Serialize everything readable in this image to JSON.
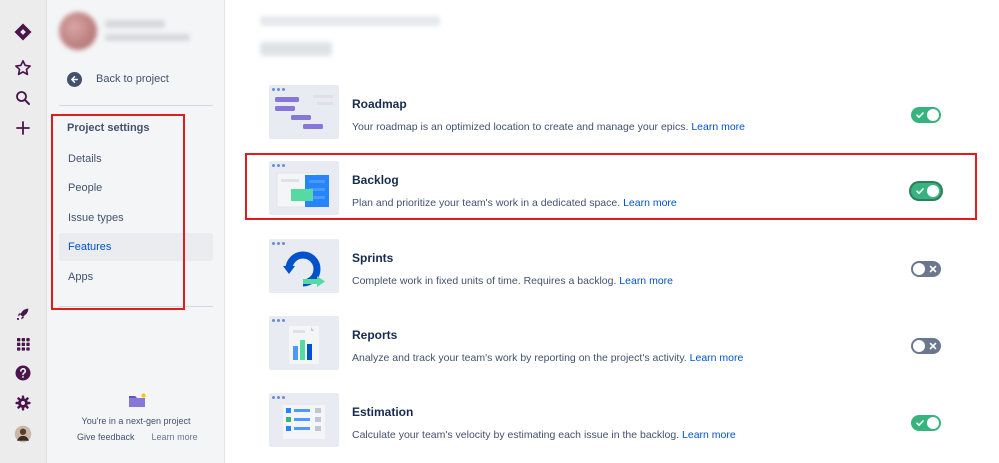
{
  "sidebar": {
    "back_label": "Back to project",
    "section_title": "Project settings",
    "items": [
      {
        "label": "Details",
        "active": false
      },
      {
        "label": "People",
        "active": false
      },
      {
        "label": "Issue types",
        "active": false
      },
      {
        "label": "Features",
        "active": true
      },
      {
        "label": "Apps",
        "active": false
      }
    ],
    "nextgen_text": "You're in a next-gen project",
    "feedback_label": "Give feedback",
    "learn_more_label": "Learn more"
  },
  "rail": {
    "icons": [
      "jira-logo-icon",
      "star-icon",
      "search-icon",
      "plus-icon",
      "rocket-icon",
      "apps-grid-icon",
      "help-icon",
      "settings-gear-icon",
      "user-avatar-icon"
    ]
  },
  "features": [
    {
      "title": "Roadmap",
      "description": "Your roadmap is an optimized location to create and manage your epics.",
      "link": "Learn more",
      "enabled": true
    },
    {
      "title": "Backlog",
      "description": "Plan and prioritize your team's work in a dedicated space.",
      "link": "Learn more",
      "enabled": true
    },
    {
      "title": "Sprints",
      "description": "Complete work in fixed units of time. Requires a backlog.",
      "link": "Learn more",
      "enabled": false
    },
    {
      "title": "Reports",
      "description": "Analyze and track your team's work by reporting on the project's activity.",
      "link": "Learn more",
      "enabled": false
    },
    {
      "title": "Estimation",
      "description": "Calculate your team's velocity by estimating each issue in the backlog.",
      "link": "Learn more",
      "enabled": true
    }
  ],
  "colors": {
    "rail_bg": "#ececec",
    "rail_icon": "#4a154b",
    "toggle_on": "#36b37e",
    "toggle_off": "#6b778c",
    "link": "#0052cc",
    "highlight_box": "#e21c1c"
  }
}
